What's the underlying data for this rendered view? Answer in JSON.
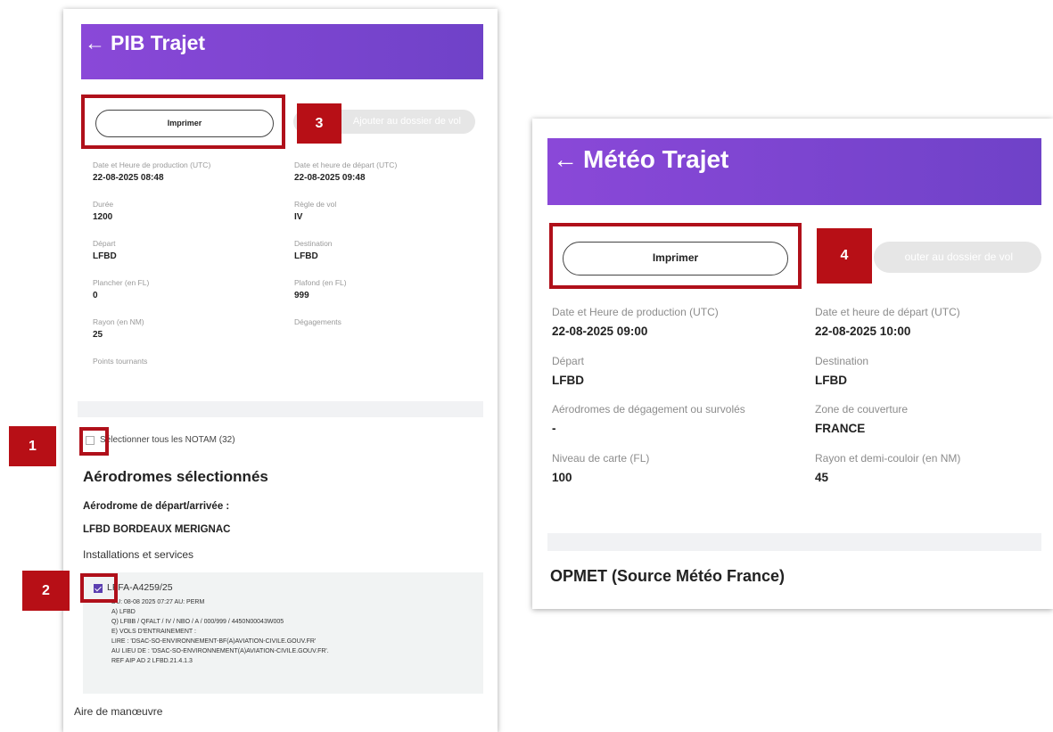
{
  "left": {
    "header": {
      "arrow": "←",
      "title": "PIB Trajet"
    },
    "print_label": "Imprimer",
    "add_label": "Ajouter au dossier de vol",
    "fields": [
      {
        "label": "Date et Heure de production (UTC)",
        "value": "22-08-2025 08:48"
      },
      {
        "label": "Date et heure de départ (UTC)",
        "value": "22-08-2025 09:48"
      },
      {
        "label": "Durée",
        "value": "1200"
      },
      {
        "label": "Règle de vol",
        "value": "IV"
      },
      {
        "label": "Départ",
        "value": "LFBD"
      },
      {
        "label": "Destination",
        "value": "LFBD"
      },
      {
        "label": "Plancher (en FL)",
        "value": "0"
      },
      {
        "label": "Plafond (en FL)",
        "value": "999"
      },
      {
        "label": "Rayon (en NM)",
        "value": "25"
      },
      {
        "label": "Dégagements",
        "value": ""
      },
      {
        "label": "Points tournants",
        "value": ""
      }
    ],
    "select_all": "Sélectionner tous les NOTAM (32)",
    "section_title": "Aérodromes sélectionnés",
    "aero_label": "Aérodrome de départ/arrivée :",
    "aero_name": "LFBD BORDEAUX MERIGNAC",
    "installations": "Installations et services",
    "notam": {
      "id": "LFFA-A4259/25",
      "lines": [
        "DU: 08-08 2025 07:27 AU: PERM",
        "A) LFBD",
        "Q) LFBB / QFALT / IV / NBO / A / 000/999 / 4450N00043W005",
        "E) VOLS D'ENTRAINEMENT :",
        "LIRE : 'DSAC-SO-ENVIRONNEMENT-BF(A)AVIATION-CIVILE.GOUV.FR'",
        "AU LIEU DE : 'DSAC-SO-ENVIRONNEMENT(A)AVIATION-CIVILE.GOUV.FR'.",
        "REF AIP AD 2 LFBD.21.4.1.3"
      ]
    },
    "aire": "Aire de manœuvre"
  },
  "right": {
    "header": {
      "arrow": "←",
      "title": "Météo Trajet"
    },
    "print_label": "Imprimer",
    "add_label": "outer au dossier de vol",
    "fields": [
      {
        "label": "Date et Heure de production (UTC)",
        "value": "22-08-2025 09:00"
      },
      {
        "label": "Date et heure de départ (UTC)",
        "value": "22-08-2025 10:00"
      },
      {
        "label": "Départ",
        "value": "LFBD"
      },
      {
        "label": "Destination",
        "value": "LFBD"
      },
      {
        "label": "Aérodromes de dégagement ou survolés",
        "value": "-"
      },
      {
        "label": "Zone de couverture",
        "value": "FRANCE"
      },
      {
        "label": "Niveau de carte (FL)",
        "value": "100"
      },
      {
        "label": "Rayon et demi-couloir (en NM)",
        "value": "45"
      }
    ],
    "opmet_title": "OPMET (Source Météo France)"
  },
  "tags": {
    "t1": "1",
    "t2": "2",
    "t3": "3",
    "t4": "4"
  },
  "colors": {
    "header_start": "#8a48d8",
    "header_end": "#6f42c8",
    "highlight": "#b0101a",
    "tag": "#b70f16",
    "checkbox_checked": "#5b3fb0"
  }
}
